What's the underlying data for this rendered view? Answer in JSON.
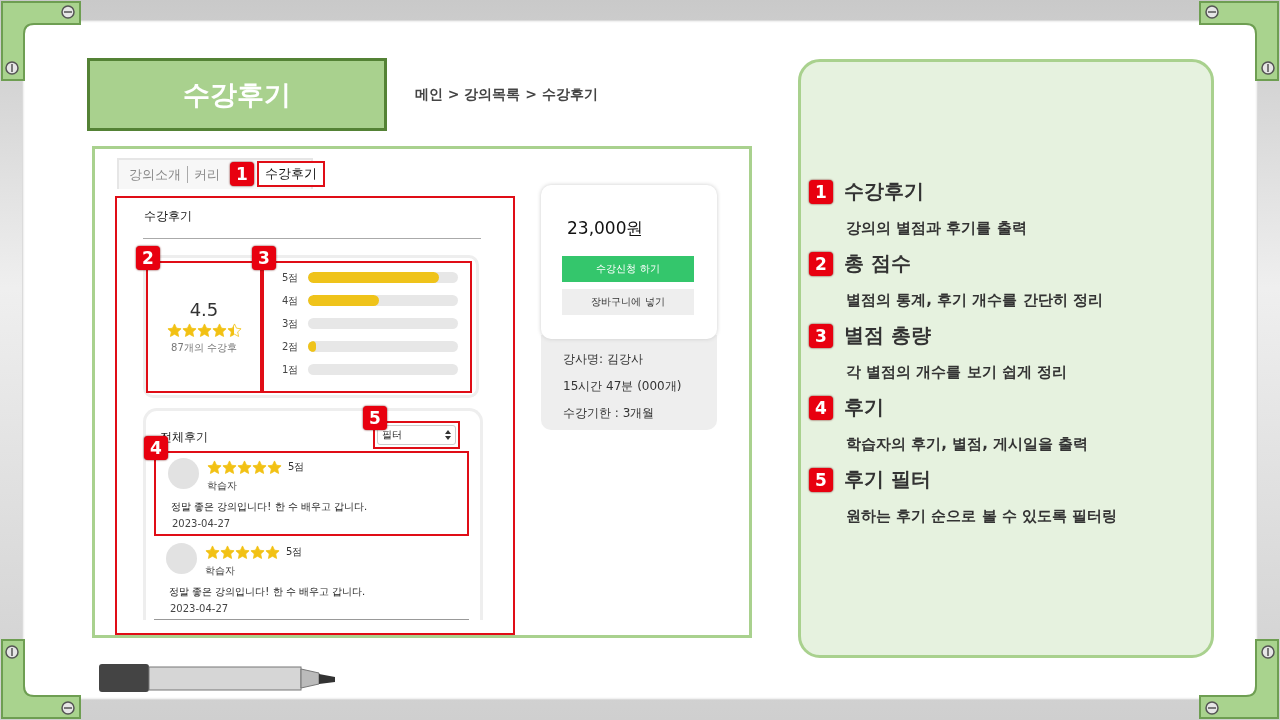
{
  "page_title": "수강후기",
  "breadcrumb": "메인 > 강의목록 > 수강후기",
  "tabs": [
    {
      "label": "강의소개",
      "selected": false
    },
    {
      "label": "커리",
      "selected": false
    },
    {
      "label": "수강후기",
      "selected": true,
      "badge": "1"
    }
  ],
  "section_title": "수강후기",
  "summary": {
    "badge": "2",
    "score": "4.5",
    "stars": 4.5,
    "count": "87개의 수강후"
  },
  "rating_bars": {
    "badge": "3",
    "rows": [
      {
        "label": "5점",
        "level": 0.87
      },
      {
        "label": "4점",
        "level": 0.47
      },
      {
        "label": "3점",
        "level": 0
      },
      {
        "label": "2점",
        "level": 0.05
      },
      {
        "label": "1점",
        "level": 0
      }
    ]
  },
  "reviews_title": "전체후기",
  "filter": {
    "badge": "5",
    "value": "필터"
  },
  "reviews": [
    {
      "badge": "4",
      "stars": 5,
      "score": "5점",
      "author": "학습자",
      "text": "정말 좋은 강의입니다! 한 수 배우고 갑니다.",
      "date": "2023-04-27"
    },
    {
      "stars": 5,
      "score": "5점",
      "author": "학습자",
      "text": "정말 좋은 강의입니다! 한 수 배우고 갑니다.",
      "date": "2023-04-27"
    }
  ],
  "purchase": {
    "price": "23,000원",
    "enroll_button": "수강신청 하기",
    "cart_button": "장바구니에 넣기",
    "details": [
      "강사명: 김강사",
      "15시간 47분 (000개)",
      "수강기한 : 3개월"
    ]
  },
  "annotations": [
    {
      "number": "1",
      "title": "수강후기",
      "description": "강의의 별점과 후기를 출력"
    },
    {
      "number": "2",
      "title": "총 점수",
      "description": "별점의 통계, 후기 개수를 간단히 정리"
    },
    {
      "number": "3",
      "title": "별점 총량",
      "description": "각 별점의 개수를 보기 쉽게 정리"
    },
    {
      "number": "4",
      "title": "후기",
      "description": "학습자의 후기, 별점, 게시일을 출력"
    },
    {
      "number": "5",
      "title": "후기 필터",
      "description": "원하는 후기 순으로 볼 수 있도록 필터링"
    }
  ]
}
